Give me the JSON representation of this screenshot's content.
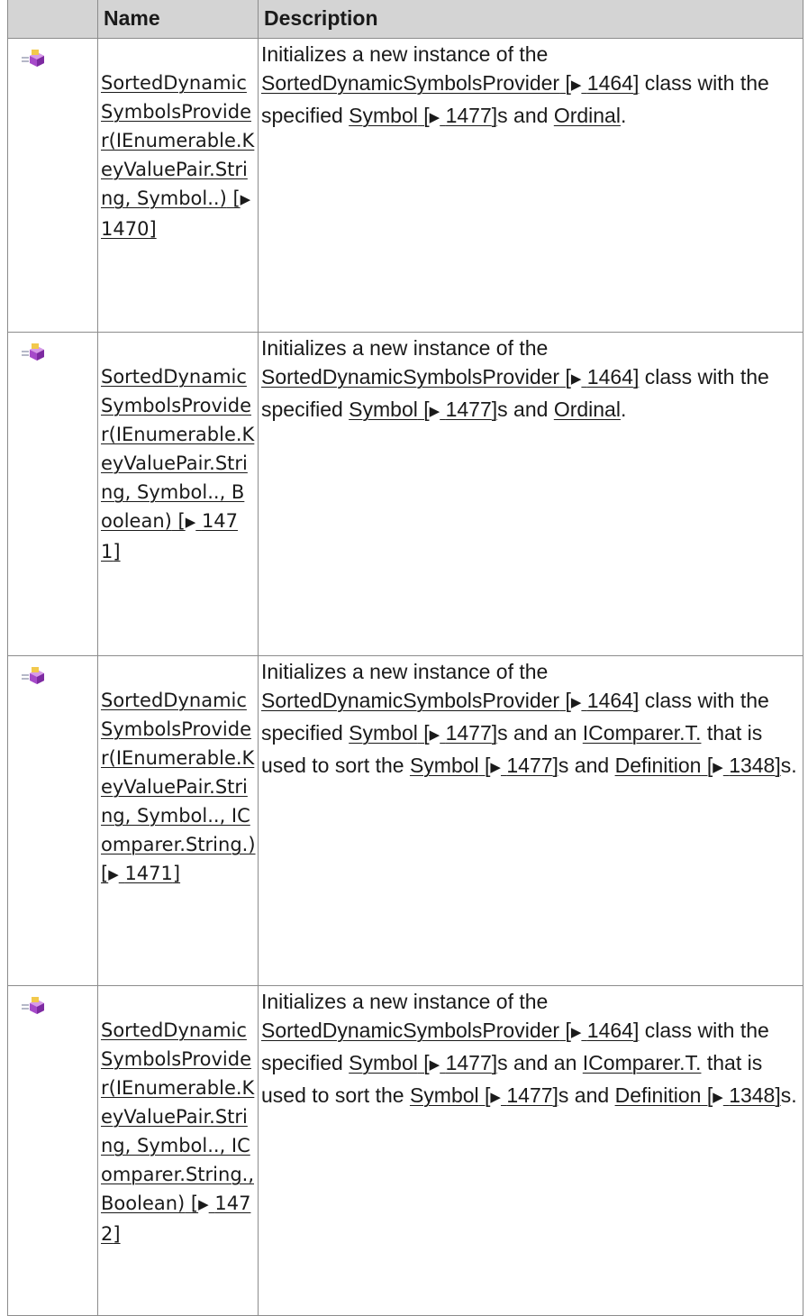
{
  "columns": [
    "",
    "Name",
    "Description"
  ],
  "rows": [
    {
      "icon": "constructor-icon",
      "name": {
        "text": "SortedDynamicSymbolsProvider(IEnumerable.KeyValuePair.String, Symbol..)",
        "ref": "1470"
      },
      "desc": {
        "line1": "Initializes a new instance of the",
        "class_link": "SortedDynamicSymbolsProvider",
        "class_ref": "1464",
        "after_class": "class with the specified",
        "symbol_link": "Symbol",
        "symbol_ref": "1477",
        "after_symbol": "s and",
        "ordinal_link": "Ordinal",
        "end": "."
      }
    },
    {
      "icon": "constructor-icon",
      "name": {
        "text": "SortedDynamicSymbolsProvider(IEnumerable.KeyValuePair.String, Symbol.., Boolean)",
        "ref": "1471"
      },
      "desc": {
        "line1": "Initializes a new instance of the",
        "class_link": "SortedDynamicSymbolsProvider",
        "class_ref": "1464",
        "after_class": "class with the specified",
        "symbol_link": "Symbol",
        "symbol_ref": "1477",
        "after_symbol": "s and",
        "ordinal_link": "Ordinal",
        "end": "."
      }
    },
    {
      "icon": "constructor-icon",
      "name": {
        "text": "SortedDynamicSymbolsProvider(IEnumerable.KeyValuePair.String, Symbol.., IComparer.String.)",
        "ref": "1471"
      },
      "desc": {
        "line1": "Initializes a new instance of the",
        "class_link": "SortedDynamicSymbolsProvider",
        "class_ref": "1464",
        "after_class": "class with the specified",
        "symbol_link": "Symbol",
        "symbol_ref": "1477",
        "after_symbol": "s and an",
        "comparer_link": "IComparer.T.",
        "mid": "that is used to sort the",
        "symbol2_link": "Symbol",
        "symbol2_ref": "1477",
        "after_symbol2": "s and",
        "definition_link": "Definition",
        "definition_ref": "1348",
        "end": "s."
      }
    },
    {
      "icon": "constructor-icon",
      "name": {
        "text": "SortedDynamicSymbolsProvider(IEnumerable.KeyValuePair.String, Symbol.., IComparer.String., Boolean)",
        "ref": "1472"
      },
      "desc": {
        "line1": "Initializes a new instance of the",
        "class_link": "SortedDynamicSymbolsProvider",
        "class_ref": "1464",
        "after_class": "class with the specified",
        "symbol_link": "Symbol",
        "symbol_ref": "1477",
        "after_symbol": "s and an",
        "comparer_link": "IComparer.T.",
        "mid": "that is used to sort the",
        "symbol2_link": "Symbol",
        "symbol2_ref": "1477",
        "after_symbol2": "s and",
        "definition_link": "Definition",
        "definition_ref": "1348",
        "end": "s."
      }
    }
  ],
  "arrow_glyph": "▶"
}
